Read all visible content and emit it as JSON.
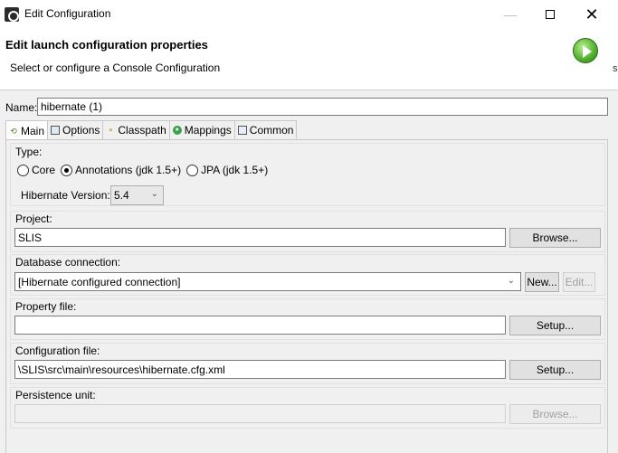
{
  "window": {
    "title": "Edit Configuration",
    "minimize_glyph": "—",
    "close_glyph": "✕"
  },
  "header": {
    "title": "Edit launch configuration properties",
    "message": "Select or configure a Console Configuration",
    "edge_text": "s",
    "icon": "run-icon"
  },
  "name": {
    "label": "Name:",
    "value": "hibernate (1)"
  },
  "tabs": [
    {
      "label": "Main",
      "icon": "main-tab-icon",
      "active": true
    },
    {
      "label": "Options",
      "icon": "options-tab-icon",
      "active": false
    },
    {
      "label": "Classpath",
      "icon": "classpath-tab-icon",
      "active": false
    },
    {
      "label": "Mappings",
      "icon": "mappings-tab-icon",
      "active": false
    },
    {
      "label": "Common",
      "icon": "common-tab-icon",
      "active": false
    }
  ],
  "type_group": {
    "label": "Type:",
    "options": [
      {
        "label": "Core",
        "checked": false
      },
      {
        "label": "Annotations (jdk 1.5+)",
        "checked": true
      },
      {
        "label": "JPA (jdk 1.5+)",
        "checked": false
      }
    ],
    "hibernate_version_label": "Hibernate Version:",
    "hibernate_version_value": "5.4"
  },
  "project": {
    "label": "Project:",
    "value": "SLIS",
    "button": "Browse..."
  },
  "database_connection": {
    "label": "Database connection:",
    "value": "[Hibernate configured connection]",
    "new_button": "New...",
    "edit_button": "Edit..."
  },
  "property_file": {
    "label": "Property file:",
    "value": "",
    "button": "Setup..."
  },
  "configuration_file": {
    "label": "Configuration file:",
    "value": "\\SLIS\\src\\main\\resources\\hibernate.cfg.xml",
    "button": "Setup..."
  },
  "persistence_unit": {
    "label": "Persistence unit:",
    "value": "",
    "button": "Browse..."
  }
}
